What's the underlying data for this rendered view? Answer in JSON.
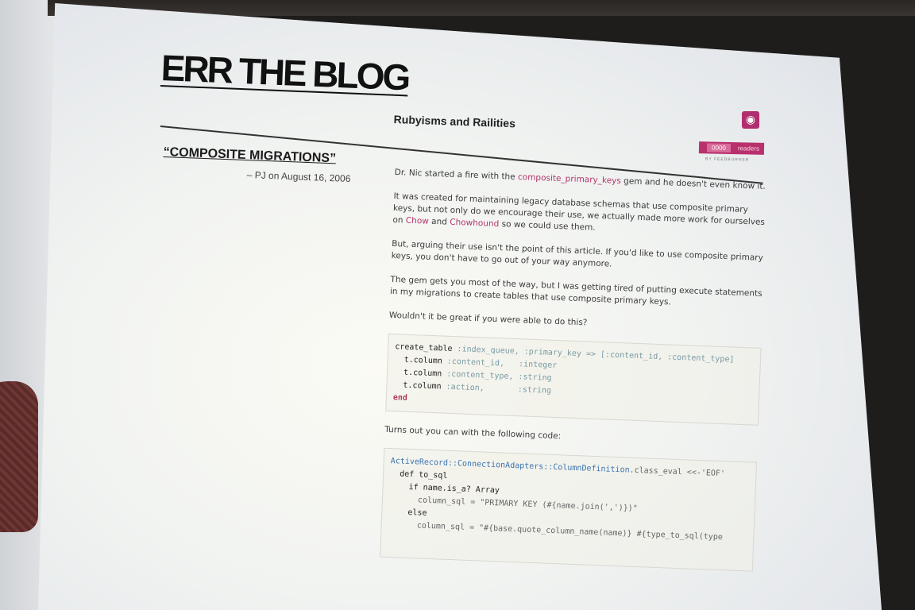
{
  "blog": {
    "title": "ERR THE BLOG",
    "tagline": "Rubyisms and Railities",
    "feed_count": "0000",
    "feed_label": "readers",
    "feed_provider": "BY FEEDBURNER"
  },
  "post": {
    "title": "“COMPOSITE MIGRATIONS”",
    "meta": "– PJ on August 16, 2006",
    "p1": {
      "before": "Dr. Nic started a fire with the ",
      "link": "composite_primary_keys",
      "after": " gem and he doesn't even know it."
    },
    "p2": {
      "before": "It was created for maintaining legacy database schemas that use composite primary keys, but not only do we encourage their use, we actually made more work for ourselves on ",
      "link1": "Chow",
      "mid": " and ",
      "link2": "Chowhound",
      "after": " so we could use them."
    },
    "p3": "But, arguing their use isn't the point of this article. If you'd like to use composite primary keys, you don't have to go out of your way anymore.",
    "p4": "The gem gets you most of the way, but I was getting tired of putting execute statements in my migrations to create tables that use composite primary keys.",
    "p5": "Wouldn't it be great if you were able to do this?",
    "code1": {
      "l1a": "create_table ",
      "l1b": ":index_queue, :primary_key => [:content_id, :content_type]",
      "l2a": "  t.column ",
      "l2b": ":content_id,   :integer",
      "l3a": "  t.column ",
      "l3b": ":content_type, :string",
      "l4a": "  t.column ",
      "l4b": ":action,       :string",
      "l5": "end"
    },
    "p6": "Turns out you can with the following code:",
    "code2": {
      "l1a": "ActiveRecord::ConnectionAdapters::ColumnDefinition",
      "l1b": ".class_eval <<-'EOF'",
      "l2": "  def to_sql",
      "l3": "    if name.is_a? Array",
      "l4": "      column_sql = \"PRIMARY KEY (#{name.join(',')})\"",
      "l5": "    else",
      "l6": "      column_sql = \"#{base.quote_column_name(name)} #{type_to_sql(type"
    }
  },
  "colors": {
    "accent": "#b2336b",
    "link": "#b2336b"
  },
  "icons": {
    "rss": "rss-icon"
  }
}
